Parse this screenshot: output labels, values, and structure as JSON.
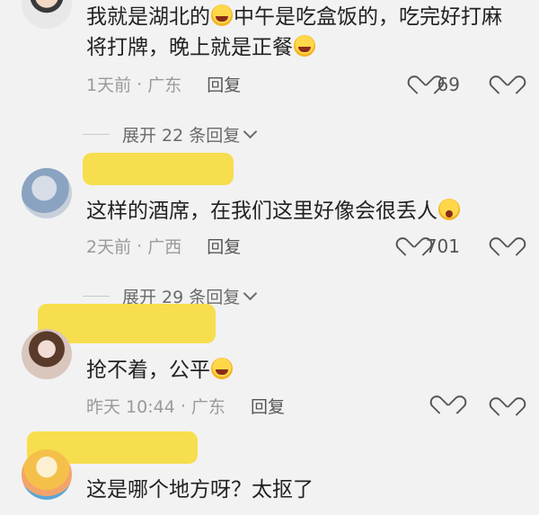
{
  "comments": [
    {
      "text_a": "我就是湖北的",
      "text_b": "中午是吃盒饭的，吃完好打麻",
      "text_c": "将打牌，晚上就是正餐",
      "time": "1天前",
      "location": "广东",
      "reply": "回复",
      "likes": "69",
      "expand": "展开 22 条回复"
    },
    {
      "text_a": "这样的酒席，在我们这里好像会很丢人",
      "time": "2天前",
      "location": "广西",
      "reply": "回复",
      "likes": "701",
      "expand": "展开 29 条回复"
    },
    {
      "text_a": "抢不着，公平",
      "time": "昨天 10:44",
      "location": "广东",
      "reply": "回复",
      "likes": ""
    },
    {
      "text_a": "这是哪个地方呀？太抠了"
    }
  ],
  "icons": [
    "laughing-emoji-icon",
    "heart-icon",
    "broken-heart-icon",
    "chevron-down-icon",
    "shocked-emoji-icon"
  ]
}
